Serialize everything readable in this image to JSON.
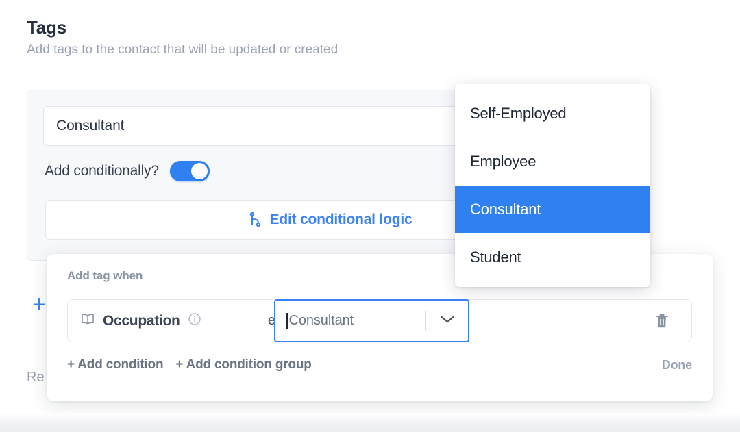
{
  "section": {
    "title": "Tags",
    "subtitle": "Add tags to the contact that will be updated or created"
  },
  "tag_card": {
    "tag_value": "Consultant",
    "conditional_label": "Add conditionally?",
    "toggle_state": "on",
    "edit_logic_label": "Edit conditional logic"
  },
  "background": {
    "add_row_plus": "+",
    "remove_text": "Re"
  },
  "logic_popup": {
    "title": "Add tag when",
    "condition": {
      "field_label": "Occupation",
      "field_icon": "book-icon",
      "info_icon": "info-circle-icon",
      "operator": "equals",
      "value": "Consultant",
      "delete_icon": "trash-icon"
    },
    "add_condition_label": "+ Add condition",
    "add_condition_group_label": "+ Add condition group",
    "done_label": "Done"
  },
  "dropdown": {
    "options": [
      {
        "label": "Self-Employed",
        "selected": false
      },
      {
        "label": "Employee",
        "selected": false
      },
      {
        "label": "Consultant",
        "selected": true
      },
      {
        "label": "Student",
        "selected": false
      }
    ]
  },
  "colors": {
    "accent_blue": "#2F80F0",
    "link_blue": "#3B82F6",
    "card_bg": "#F7F8FA",
    "text_dark": "#27303F",
    "text_muted": "#9AA2B1"
  }
}
